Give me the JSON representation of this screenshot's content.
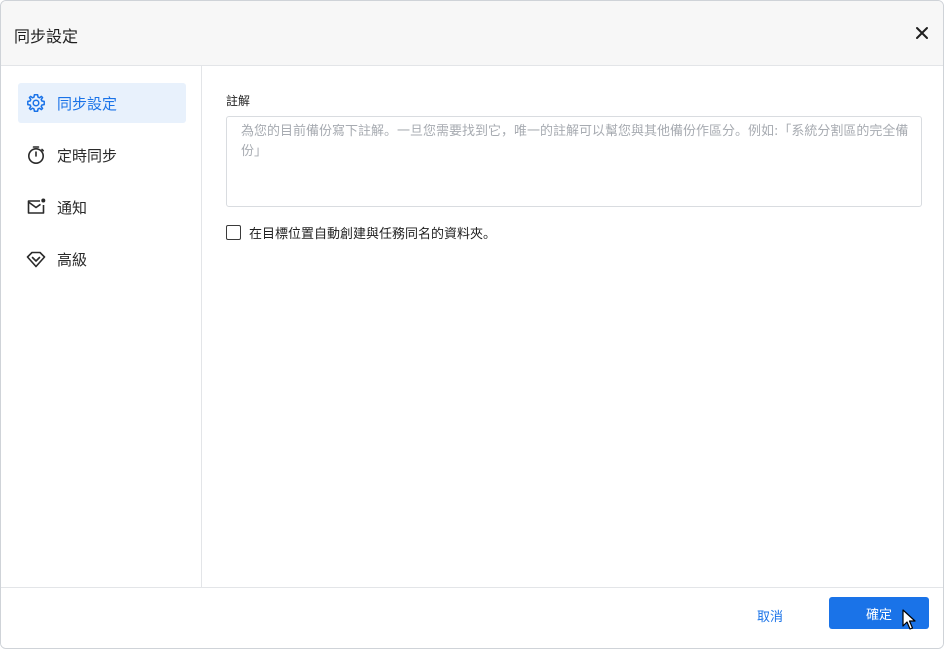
{
  "dialog": {
    "title": "同步設定",
    "close_icon": "close-icon"
  },
  "sidebar": {
    "items": [
      {
        "label": "同步設定",
        "icon": "gear-icon",
        "active": true
      },
      {
        "label": "定時同步",
        "icon": "stopwatch-icon",
        "active": false
      },
      {
        "label": "通知",
        "icon": "mail-notification-icon",
        "active": false
      },
      {
        "label": "高級",
        "icon": "diamond-icon",
        "active": false
      }
    ]
  },
  "main": {
    "comment_label": "註解",
    "comment_placeholder": "為您的目前備份寫下註解。一旦您需要找到它，唯一的註解可以幫您與其他備份作區分。例如:「系統分割區的完全備份」",
    "comment_value": "",
    "create_folder_checkbox": {
      "label": "在目標位置自動創建與任務同名的資料夾。",
      "checked": false
    }
  },
  "footer": {
    "cancel_label": "取消",
    "ok_label": "確定"
  },
  "colors": {
    "accent": "#1a73e8",
    "active_bg": "#e8f1fc",
    "title_bg": "#f7f7f7"
  }
}
